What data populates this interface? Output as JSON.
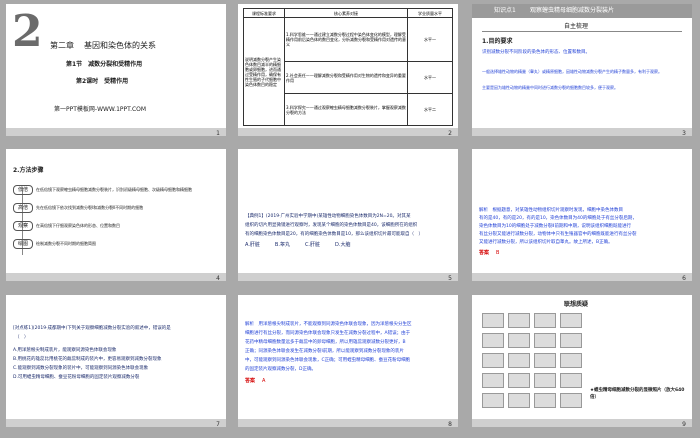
{
  "slides": [
    {
      "num": "1",
      "big_number": "2",
      "chapter": "第二章",
      "chapter_title": "基因和染色体的关系",
      "section": "第1节　减数分裂和受精作用",
      "lesson": "第2课时　受精作用",
      "footer": "第一PPT模板网-WWW.1PPT.COM"
    },
    {
      "num": "2",
      "header_left": "课程标准要求",
      "header_mid": "核心素养对接",
      "header_right": "学业质量水平",
      "col_left": "说明减数分裂产生染色体数目减半的精细胞或卵细胞，进而通过受精作用，确保有性生殖的子代细胞中染色体数目的稳定",
      "rows": [
        {
          "text": "1.科学思维——通过建立减数分裂过程中染色体变化的模型，理解受精作用前后染色体的数目变化，分析减数分裂和受精作用对遗传的意义",
          "level": "水平一"
        },
        {
          "text": "2.社会责任——理解减数分裂和受精作用对生物的遗传和变异的重要作用",
          "level": "水平一"
        },
        {
          "text": "3.科学探究——通过观察蝗虫精母细胞减数分裂装片，掌握观察减数分裂的方法",
          "level": "水平二"
        }
      ]
    },
    {
      "num": "3",
      "tag": "知识点1",
      "heading": "观察蝗虫精母细胞减数分裂装片",
      "subheading": "自主梳理",
      "item_title": "1.目的要求",
      "lines": [
        "识别减数分裂不同阶段的染色体的形态、位置和数目。",
        "一般选择雄性动物的精巢（睾丸）或精原细胞，因雄性动物减数分裂产生的精子数量多，有利于观察。",
        "主要是因为雄性动物的精巢中同时进行减数分裂的细胞数目较多，便于观察。"
      ]
    },
    {
      "num": "4",
      "heading": "2.方法步骤",
      "steps": [
        {
          "label": "低倍",
          "text": "在低倍镜下观察蝗虫精母细胞减数分裂装片，识别初级精母细胞、次级精母细胞和精细胞"
        },
        {
          "label": "高倍",
          "text": "先在低倍镜下依次找到减数分裂Ⅰ和减数分裂Ⅱ不同时期的细胞"
        },
        {
          "label": "观察",
          "text": "在高倍镜下仔细观察染色体的形态、位置和数目"
        },
        {
          "label": "绘图",
          "text": "绘制减数分裂不同时期的细胞简图"
        }
      ]
    },
    {
      "num": "5",
      "lines": [
        "【典例1】(2019·广州实验中学期中)某雄性动物细胞染色体数目为2N=20。对其某",
        "组织的切片用显微镜进行观察时，发现某个细胞的染色体数目是40，该细胞所在的组织",
        "有的细胞染色体数目是20，有的细胞染色体数目是10，那么该组织切片最可能取自（　）"
      ],
      "options": "A.肝脏　　　B.睾丸　　　C.肝脏　　　D.大脑"
    },
    {
      "num": "6",
      "lines": [
        "解析　根据题意，对某雄性动物组织切片观察时发现，细胞中染色体数目",
        "有的是40，有的是20，有的是10，染色体数目为40的细胞处于有丝分裂后期，",
        "染色体数目为10的细胞处于减数分裂Ⅱ前期和中期，说明该组织细胞既能进行",
        "有丝分裂又能进行减数分裂，动物体中只有生殖器官中的细胞既能进行有丝分裂",
        "又能进行减数分裂，所以该组织切片取自睾丸。故上所述，B正确。"
      ],
      "answer_label": "答案",
      "answer": "B"
    },
    {
      "num": "7",
      "lines": [
        "[对点练1](2019·成都期中)下列关于观察细胞减数分裂实验的叙述中，错误的是",
        "（　）"
      ],
      "options": [
        "A.用洋葱根尖制成装片，能观察同源染色体联会现象",
        "B.用桃花的雄蕊比用桃花的雌蕊制成的装片中，更容易观察到减数分裂现象",
        "C.能观察到减数分裂现象的装片中，可能观察到同源染色体联会现象",
        "D.可用蝗虫精母细胞、蚕豆花粉母细胞的固定装片观察减数分裂"
      ]
    },
    {
      "num": "8",
      "lines": [
        "解析　用洋葱根尖制成装片，不能观察到同源染色体联会现象，因为洋葱根尖分生区",
        "细胞进行有丝分裂，而同源染色体联会现象只发生在减数分裂过程中，A错误；由于",
        "花药中精母细胞数量远多于雌蕊中的卵母细胞，所以用雄蕊观察减数分裂更好，B",
        "正确；同源染色体联会发生在减数分裂Ⅰ前期，所以能观察到减数分裂现象的装片",
        "中，可能观察到同源染色体联会现象，C正确；可用蝗虫精母细胞、蚕豆花粉母细胞",
        "的固定装片观察减数分裂，D正确。"
      ],
      "answer_label": "答案",
      "answer": "A"
    },
    {
      "num": "9",
      "heading": "联想质疑",
      "caption": "★蝗虫精母细胞减数分裂的显微照片（放大640倍）"
    }
  ]
}
